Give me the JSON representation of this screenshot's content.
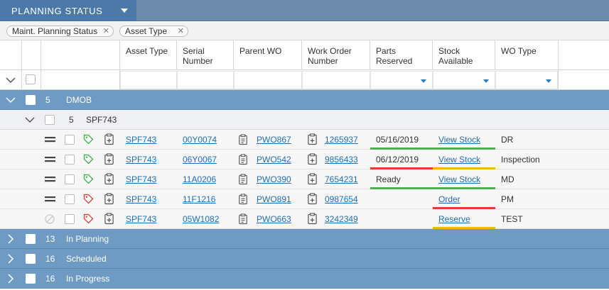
{
  "header": {
    "title": "PLANNING STATUS"
  },
  "chips": [
    {
      "label": "Maint. Planning Status"
    },
    {
      "label": "Asset Type"
    }
  ],
  "columns": {
    "asset_type": "Asset Type",
    "serial_number": "Serial Number",
    "parent_wo": "Parent WO",
    "work_order_number": "Work Order Number",
    "parts_reserved": "Parts Reserved",
    "stock_available": "Stock Available",
    "wo_type": "WO Type"
  },
  "groups": [
    {
      "count": "5",
      "name": "DMOB",
      "expanded": true
    },
    {
      "count": "13",
      "name": "In Planning",
      "expanded": false
    },
    {
      "count": "16",
      "name": "Scheduled",
      "expanded": false
    },
    {
      "count": "16",
      "name": "In Progress",
      "expanded": false
    }
  ],
  "subgroup": {
    "count": "5",
    "name": "SPF743"
  },
  "rows": [
    {
      "handle": "drag",
      "tag_color": "#3fae49",
      "asset_type": "SPF743",
      "serial": "00Y0074",
      "parent_wo": "PWO867",
      "wo_number": "1265937",
      "parts_reserved": "05/16/2019",
      "parts_status": "#4caf50",
      "stock": "View Stock",
      "stock_status": "#4caf50",
      "wo_type": "DR"
    },
    {
      "handle": "drag",
      "tag_color": "#3fae49",
      "asset_type": "SPF743",
      "serial": "06Y0067",
      "parent_wo": "PWO542",
      "wo_number": "9856433",
      "parts_reserved": "06/12/2019",
      "parts_status": "#e53935",
      "stock": "View Stock",
      "stock_status": "#f5b800",
      "wo_type": "Inspection"
    },
    {
      "handle": "drag",
      "tag_color": "#3fae49",
      "asset_type": "SPF743",
      "serial": "11A0206",
      "parent_wo": "PWO390",
      "wo_number": "7654231",
      "parts_reserved": "Ready",
      "parts_status": "#4caf50",
      "stock": "View Stock",
      "stock_status": "#4caf50",
      "wo_type": "MD"
    },
    {
      "handle": "drag",
      "tag_color": "#e53935",
      "asset_type": "SPF743",
      "serial": "11F1216",
      "parent_wo": "PWO891",
      "wo_number": "0987654",
      "parts_reserved": "",
      "parts_status": "",
      "stock": "Order",
      "stock_status": "#e53935",
      "wo_type": "PM"
    },
    {
      "handle": "blocked",
      "tag_color": "#e53935",
      "asset_type": "SPF743",
      "serial": "05W1082",
      "parent_wo": "PWO663",
      "wo_number": "3242349",
      "parts_reserved": "",
      "parts_status": "",
      "stock": "Reserve",
      "stock_status": "#f5b800",
      "wo_type": "TEST"
    }
  ]
}
